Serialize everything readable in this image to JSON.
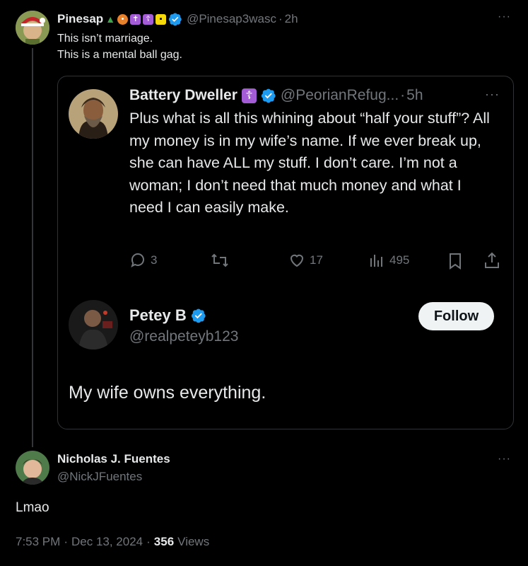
{
  "top_tweet": {
    "display_name": "Pinesap",
    "emoji_badges": [
      "tree",
      "fire-lantern",
      "cross",
      "cross",
      "vatican-flag"
    ],
    "handle": "@Pinesap3wasc",
    "separator": "·",
    "time": "2h",
    "text_line1": "This isn’t marriage.",
    "text_line2": "This is a mental ball gag.",
    "more": "···"
  },
  "quoted_tweet": {
    "display_name": "Battery Dweller",
    "badge_glyph": "☦",
    "handle": "@PeorianRefug...",
    "separator": "·",
    "time": "5h",
    "more": "···",
    "text": "Plus what is all this whining about “half your stuff”?  All my money is in my wife’s name.  If we ever break up, she can have ALL my stuff. I don’t care. I’m not a woman; I don’t need that much money and what I need I can easily make.",
    "actions": {
      "replies": "3",
      "retweets": "",
      "likes": "17",
      "views": "495"
    }
  },
  "embedded_post": {
    "display_name": "Petey B",
    "handle": "@realpeteyb123",
    "follow_label": "Follow",
    "text": "My wife owns everything."
  },
  "reply_tweet": {
    "display_name": "Nicholas J. Fuentes",
    "handle": "@NickJFuentes",
    "more": "···",
    "text": "Lmao",
    "time": "7:53 PM",
    "date_sep": "·",
    "date": "Dec 13, 2024",
    "views_sep": "·",
    "views_count": "356",
    "views_label": "Views"
  },
  "colors": {
    "background": "#000000",
    "text": "#e7e9ea",
    "muted": "#71767b",
    "verified": "#1d9bf0",
    "border": "#2f3336",
    "badge_purple": "#a35bd6"
  }
}
